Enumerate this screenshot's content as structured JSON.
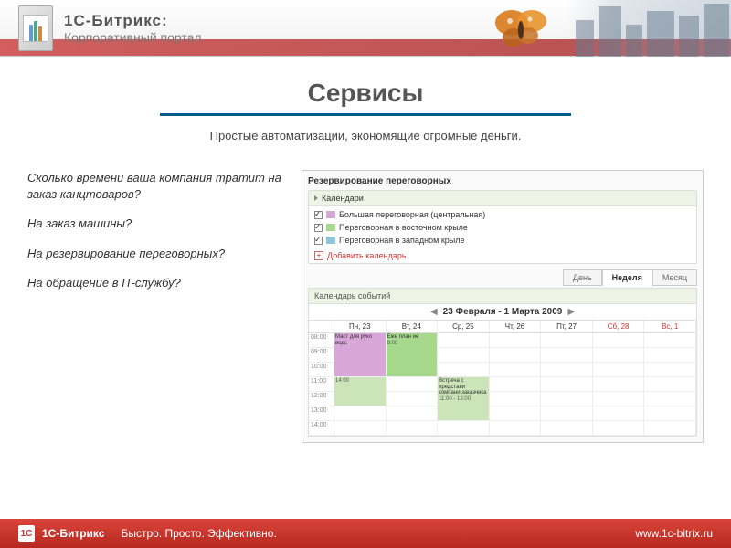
{
  "header": {
    "brand_title": "1С-Битрикс:",
    "brand_sub": "Корпоративный портал"
  },
  "page": {
    "title": "Сервисы",
    "subtitle": "Простые автоматизации, экономящие огромные деньги."
  },
  "questions": [
    "Сколько времени ваша компания тратит на заказ канцтоваров?",
    "На заказ машины?",
    "На резервирование переговорных?",
    "На обращение в IT-службу?"
  ],
  "calendar_panel": {
    "title": "Резервирование переговорных",
    "section_label": "Календари",
    "calendars": [
      {
        "label": "Большая переговорная (центральная)",
        "color": "#d9a6d9",
        "checked": true
      },
      {
        "label": "Переговорная в восточном крыле",
        "color": "#a6d98c",
        "checked": true
      },
      {
        "label": "Переговорная в западном крыле",
        "color": "#8cc6d9",
        "checked": true
      }
    ],
    "add_calendar": "Добавить календарь",
    "tabs": {
      "day": "День",
      "week": "Неделя",
      "month": "Месяц"
    },
    "events_title": "Календарь событий",
    "date_range": "23 Февраля - 1 Марта 2009",
    "days": [
      {
        "label": "Пн, 23",
        "wknd": false
      },
      {
        "label": "Вт, 24",
        "wknd": false
      },
      {
        "label": "Ср, 25",
        "wknd": false
      },
      {
        "label": "Чт, 26",
        "wknd": false
      },
      {
        "label": "Пт, 27",
        "wknd": false
      },
      {
        "label": "Сб, 28",
        "wknd": true
      },
      {
        "label": "Вс, 1",
        "wknd": true
      }
    ],
    "times": [
      "08:00",
      "09:00",
      "10:00",
      "11:00",
      "12:00",
      "13:00",
      "14:00"
    ],
    "events": [
      {
        "text": "Маст для руко водс",
        "time": "",
        "col": 0,
        "row": 0,
        "span": 3,
        "color": "#d9a6d9"
      },
      {
        "text": "Еже план ие",
        "time": "9:00",
        "col": 1,
        "row": 0,
        "span": 3,
        "color": "#a6d98c"
      },
      {
        "text": "",
        "time": "14:00",
        "col": 0,
        "row": 3,
        "span": 2,
        "color": "#cce5b8"
      },
      {
        "text": "Встреча с представи компани заказчика",
        "time": "11:00 - 13:00",
        "col": 2,
        "row": 3,
        "span": 3,
        "color": "#cce5b8"
      }
    ]
  },
  "footer": {
    "brand": "1С-Битрикс",
    "tagline": "Быстро. Просто. Эффективно.",
    "url": "www.1c-bitrix.ru"
  }
}
